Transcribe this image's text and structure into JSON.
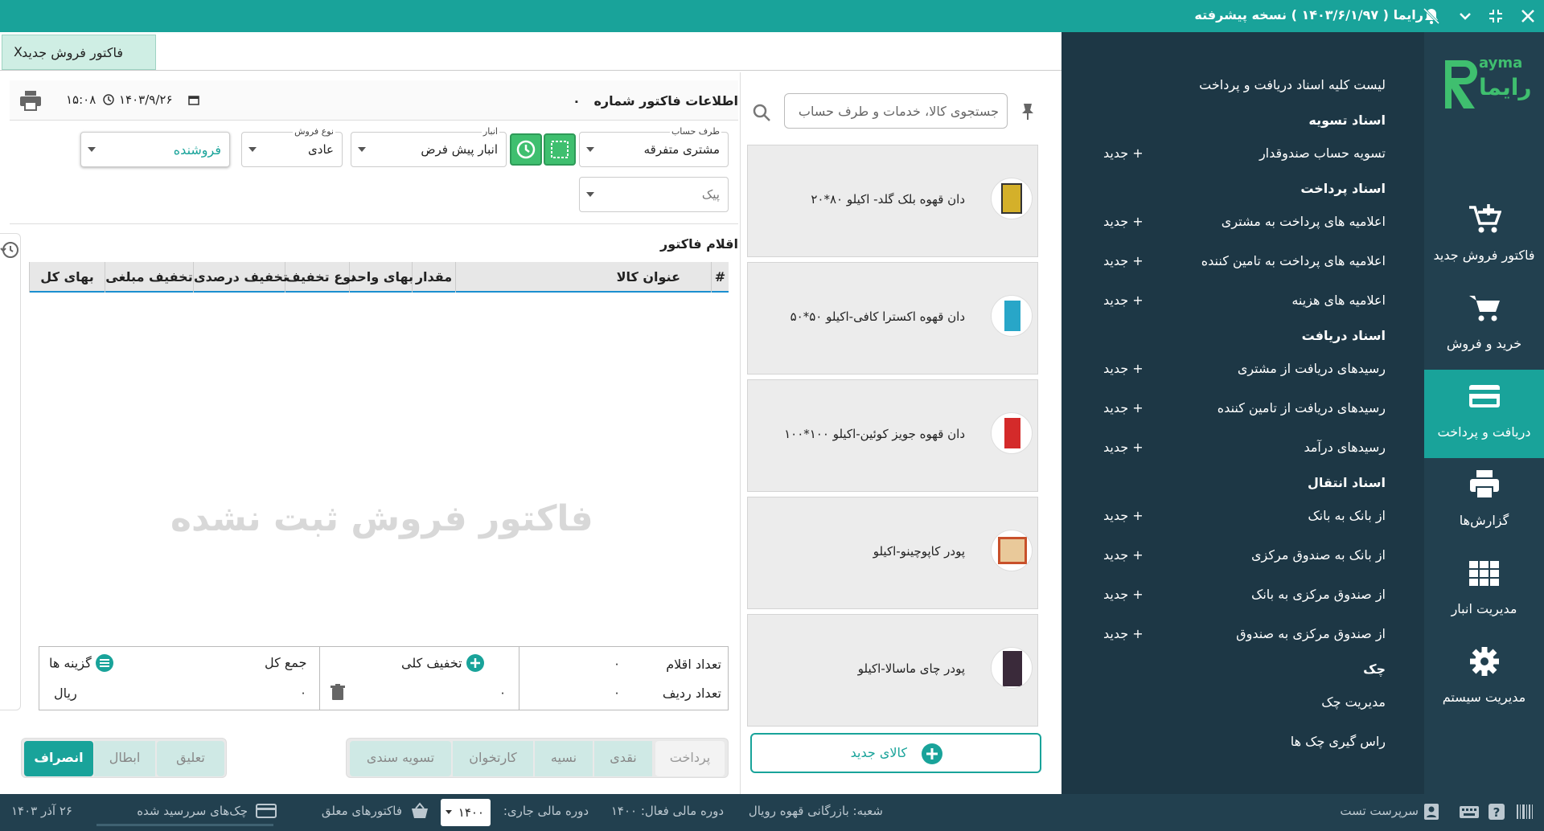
{
  "titlebar": {
    "title": "رایما ( ۱۴۰۳/۶/۱/۹۷ ) نسخه پیشرفته"
  },
  "brand": {
    "logo_text_en": "ayma",
    "logo_text_fa": "رایما"
  },
  "leftnav": [
    {
      "label": "فاکتور فروش جدید",
      "icon": "cart-plus-icon"
    },
    {
      "label": "خرید و فروش",
      "icon": "cart-icon"
    },
    {
      "label": "دریافت و پرداخت",
      "icon": "credit-card-icon",
      "active": true
    },
    {
      "label": "گزارش‌ها",
      "icon": "printer-icon"
    },
    {
      "label": "مدیریت انبار",
      "icon": "grid-icon"
    },
    {
      "label": "مدیریت سیستم",
      "icon": "gear-icon"
    }
  ],
  "menu": {
    "new_label": "جدید",
    "all_docs": "لیست کلیه اسناد دریافت و پرداخت",
    "settlement_header": "اسناد تسویه",
    "settlement_item": "تسویه حساب صندوقدار",
    "payment_header": "اسناد پرداخت",
    "payment_items": [
      "اعلامیه های پرداخت به مشتری",
      "اعلامیه های پرداخت به تامین کننده",
      "اعلامیه های هزینه"
    ],
    "receipt_header": "اسناد دریافت",
    "receipt_items": [
      "رسیدهای دریافت از مشتری",
      "رسیدهای دریافت از تامین کننده",
      "رسیدهای درآمد"
    ],
    "transfer_header": "اسناد انتقال",
    "transfer_items": [
      "از بانک به بانک",
      "از بانک به صندوق مرکزی",
      "از صندوق مرکزی به بانک",
      "از صندوق مرکزی به صندوق"
    ],
    "cheque_header": "چک",
    "cheque_items": [
      "مدیریت چک",
      "راس گیری چک ها"
    ]
  },
  "tab": {
    "label": "فاکتور فروش جدید",
    "close": "X"
  },
  "products": {
    "search_placeholder": "جستجوی کالا، خدمات و طرف حساب",
    "items": [
      "دان قهوه بلک گلد- اکیلو ۸۰*۲۰",
      "دان قهوه اکسترا کافی-اکیلو ۵۰*۵۰",
      "دان قهوه جویز کوئین-اکیلو ۱۰۰*۱۰۰",
      "پودر کاپوچینو-اکیلو",
      "پودر چای ماسالا-اکیلو"
    ],
    "new_product": "کالای جدید"
  },
  "invoice": {
    "info_title": "اطلاعات فاکتور شماره",
    "number": "۰",
    "date": "۱۴۰۳/۹/۲۶",
    "time": "۱۵:۰۸",
    "account_caption": "طرف حساب",
    "account_value": "مشتری متفرقه",
    "warehouse_caption": "انبار",
    "warehouse_value": "انبار پیش فرض",
    "sale_type_caption": "نوع فروش",
    "sale_type_value": "عادی",
    "seller_value": "فروشنده",
    "courier_placeholder": "پیک",
    "items_title": "اقلام فاکتور",
    "columns": [
      "#",
      "عنوان کالا",
      "مقدار",
      "بهای واحد",
      "نوع تخفیف",
      "تخفیف درصدی",
      "تخفیف مبلغی",
      "بهای کل"
    ],
    "empty_watermark": "فاکتور فروش ثبت نشده"
  },
  "summary": {
    "items_count_label": "تعداد اقلام",
    "items_count": "۰",
    "rows_count_label": "تعداد ردیف",
    "rows_count": "۰",
    "discount_label": "تخفیف کلی",
    "discount_value": "۰",
    "total_label": "جمع کل",
    "total_value": "۰",
    "currency": "ریال",
    "options_label": "گزینه ها"
  },
  "payment_buttons": [
    "پرداخت",
    "نقدی",
    "نسیه",
    "کارتخوان",
    "تسویه سندی"
  ],
  "action_buttons": {
    "suspend": "تعلیق",
    "void": "ابطال",
    "cancel": "انصراف"
  },
  "statusbar": {
    "user": "سرپرست تست",
    "branch": "شعبه: بازرگانی قهوه رویال",
    "active_period": "دوره مالی فعال: ۱۴۰۰",
    "current_period_label": "دوره مالی جاری:",
    "current_period_value": "۱۴۰۰",
    "pending_invoices": "فاکتورهای معلق",
    "due_cheques": "چک‌های سررسید شده",
    "date": "۲۶ آذر ۱۴۰۳"
  },
  "colors": {
    "accent": "#19a39a",
    "nav_bg": "#22404f",
    "menu_bg": "#1d3745"
  }
}
